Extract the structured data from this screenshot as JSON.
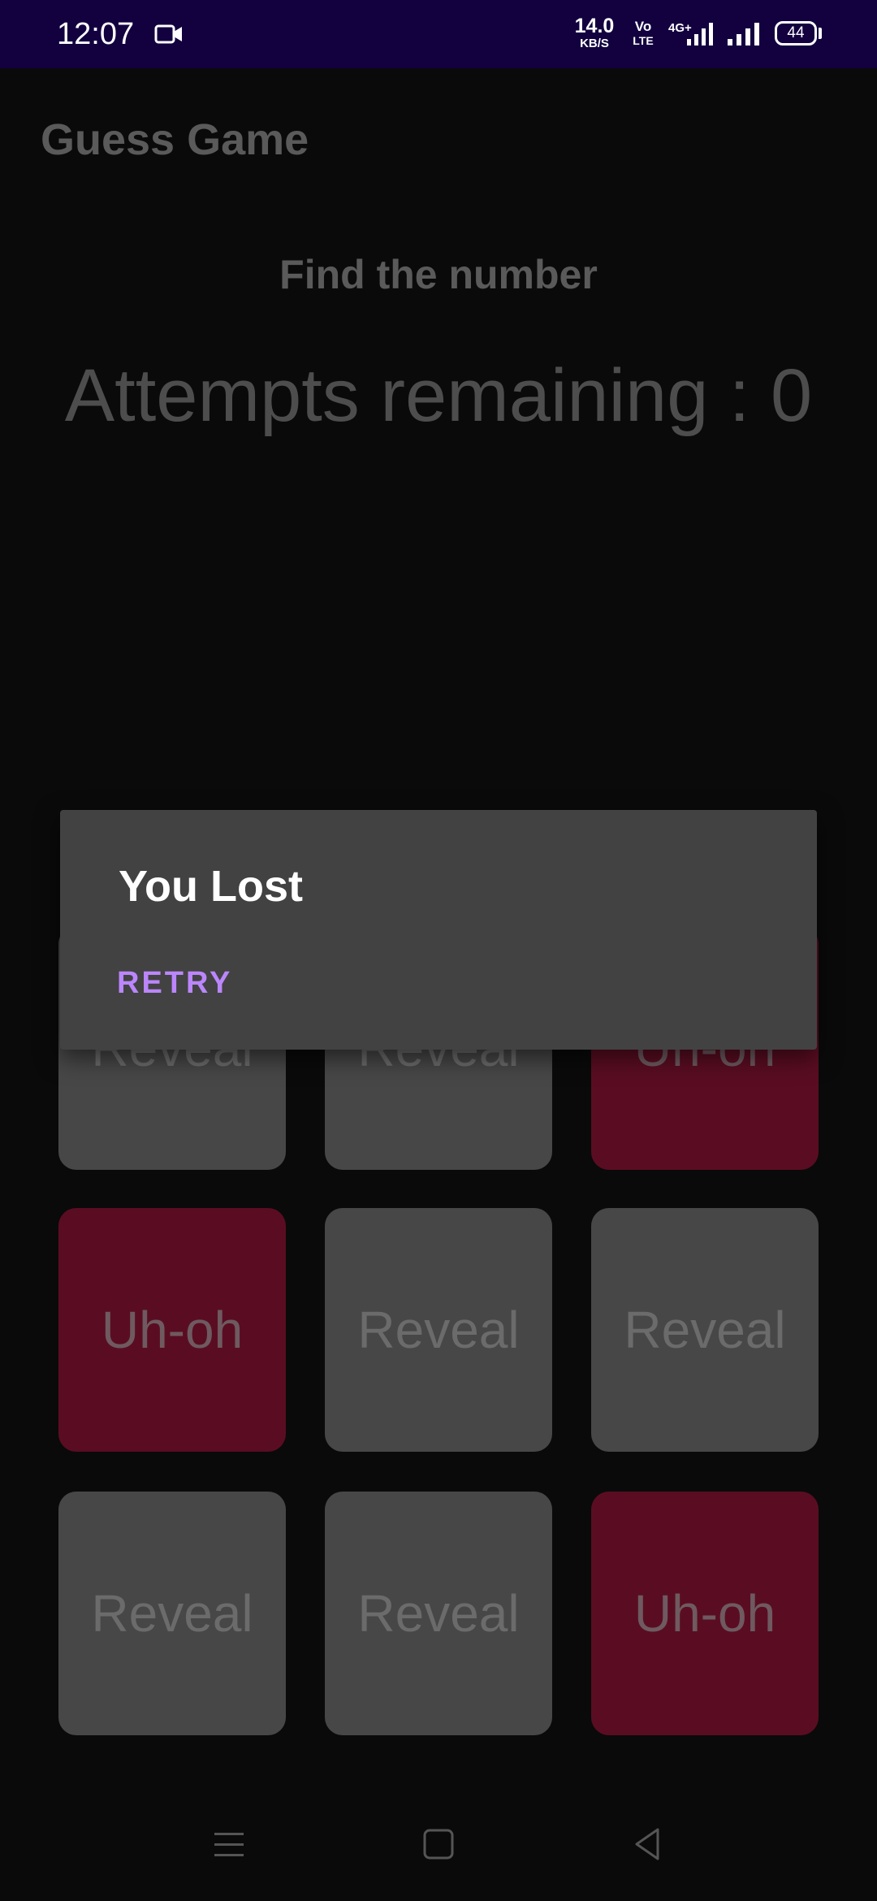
{
  "status_bar": {
    "time": "12:07",
    "net_speed_value": "14.0",
    "net_speed_unit": "KB/S",
    "volte_top": "Vo",
    "volte_bottom": "LTE",
    "network_type": "4G+",
    "battery_level": "44",
    "icons": [
      "video-camera-icon",
      "signal-icon",
      "signal-icon",
      "battery-icon"
    ]
  },
  "app": {
    "title": "Guess Game",
    "subtitle": "Find the number",
    "attempts_text": "Attempts remaining : 0"
  },
  "tiles": [
    {
      "label": "Reveal",
      "state": "reveal"
    },
    {
      "label": "Reveal",
      "state": "reveal"
    },
    {
      "label": "Uh-oh",
      "state": "miss"
    },
    {
      "label": "Uh-oh",
      "state": "miss"
    },
    {
      "label": "Reveal",
      "state": "reveal"
    },
    {
      "label": "Reveal",
      "state": "reveal"
    },
    {
      "label": "Reveal",
      "state": "reveal"
    },
    {
      "label": "Reveal",
      "state": "reveal"
    },
    {
      "label": "Uh-oh",
      "state": "miss"
    }
  ],
  "dialog": {
    "title": "You Lost",
    "action_label": "RETRY"
  },
  "nav_bar": {
    "items": [
      "menu-icon",
      "home-icon",
      "back-icon"
    ]
  },
  "colors": {
    "status_bar_bg": "#12003f",
    "background": "#0a0a0a",
    "tile_reveal": "#474747",
    "tile_miss": "#5a0d22",
    "dialog_bg": "#424242",
    "accent": "#bb86fc"
  }
}
